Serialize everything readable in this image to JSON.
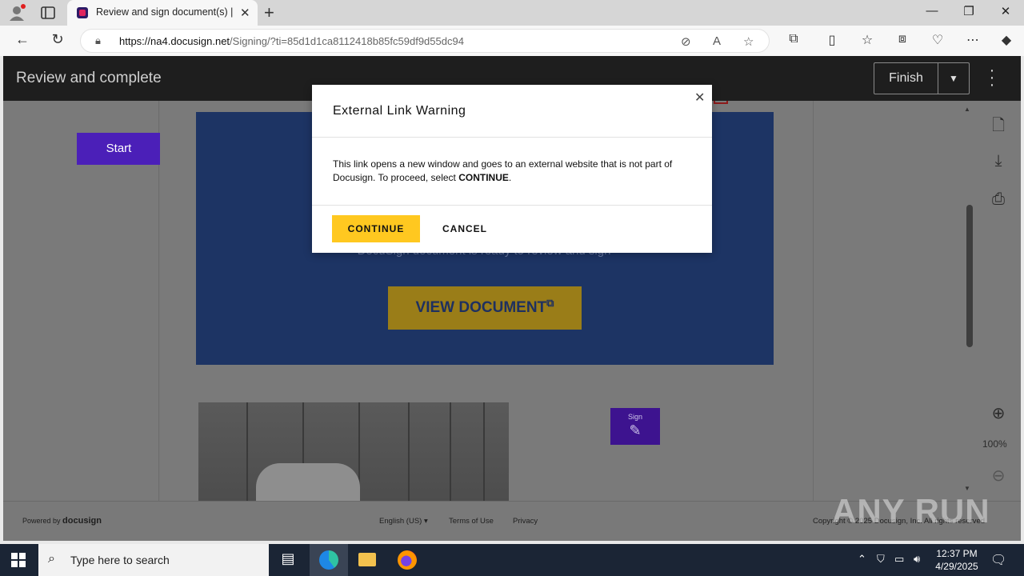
{
  "browser": {
    "tab_title": "Review and sign document(s) | D",
    "url_host": "https://na4.docusign.net",
    "url_path": "/Signing/?ti=85d1d1ca8112418b85fc59df9d55dc94"
  },
  "header": {
    "title": "Review and complete",
    "finish_label": "Finish"
  },
  "document": {
    "start_label": "Start",
    "hidden_line": "DocuSign document is ready to review and sign",
    "view_document_label": "VIEW DOCUMENT",
    "sign_label": "Sign",
    "zoom": "100%"
  },
  "footer": {
    "powered_by": "Powered by",
    "brand": "docusign",
    "language": "English (US)",
    "terms": "Terms of Use",
    "privacy": "Privacy",
    "copyright": "Copyright © 2025 Docusign, Inc. All rights reserved"
  },
  "modal": {
    "title": "External Link Warning",
    "body_prefix": "This link opens a new window and goes to an external website that is not part of Docusign. To proceed, select ",
    "body_bold": "CONTINUE",
    "body_suffix": ".",
    "continue_label": "CONTINUE",
    "cancel_label": "CANCEL"
  },
  "taskbar": {
    "search_placeholder": "Type here to search",
    "time": "12:37 PM",
    "date": "4/29/2025"
  },
  "watermark": "ANY RUN",
  "colors": {
    "docusign_purple": "#4b1fb8",
    "continue_yellow": "#ffc820",
    "header_dark": "#1e1e1e"
  }
}
